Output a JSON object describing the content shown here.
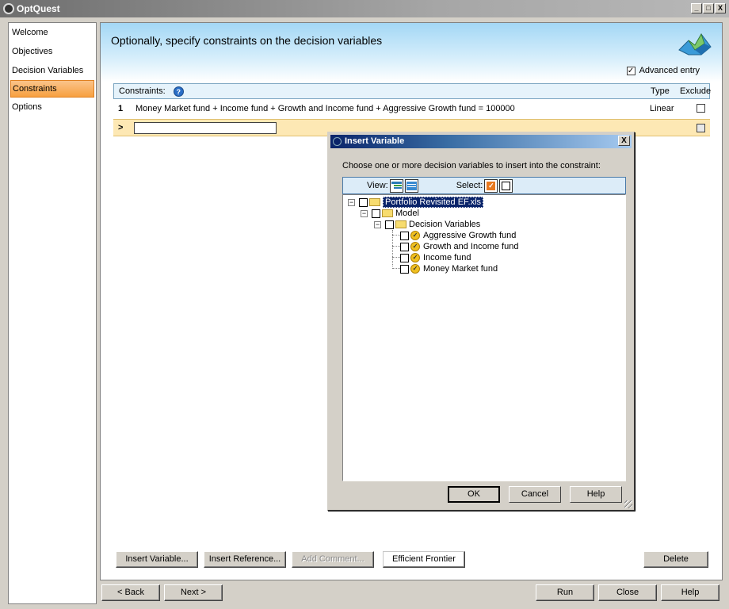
{
  "window": {
    "title": "OptQuest",
    "controls": [
      "_",
      "□",
      "X"
    ]
  },
  "nav": {
    "items": [
      {
        "label": "Welcome"
      },
      {
        "label": "Objectives"
      },
      {
        "label": "Decision Variables"
      },
      {
        "label": "Constraints",
        "active": true
      },
      {
        "label": "Options"
      }
    ]
  },
  "main": {
    "title": "Optionally, specify constraints on the decision variables",
    "advanced_entry": {
      "label": "Advanced entry",
      "checked": true
    },
    "grid": {
      "header_label": "Constraints:",
      "type_label": "Type",
      "exclude_label": "Exclude",
      "rows": [
        {
          "num": "1",
          "expression": "Money Market fund + Income fund + Growth and Income fund + Aggressive Growth fund = 100000",
          "type": "Linear",
          "exclude": false
        }
      ],
      "new_row_marker": ">"
    },
    "buttons": {
      "insert_variable": "Insert Variable...",
      "insert_reference": "Insert Reference...",
      "add_comment": "Add Comment...",
      "efficient_frontier": "Efficient Frontier",
      "delete": "Delete"
    }
  },
  "footer": {
    "back": "< Back",
    "next": "Next >",
    "run": "Run",
    "close": "Close",
    "help": "Help"
  },
  "dialog": {
    "title": "Insert Variable",
    "close": "X",
    "prompt": "Choose one or more decision variables to insert into the constraint:",
    "view_label": "View:",
    "select_label": "Select:",
    "tree": {
      "root": "Portfolio Revisited EF.xls",
      "model": "Model",
      "group": "Decision Variables",
      "variables": [
        "Aggressive Growth fund",
        "Growth and Income fund",
        "Income fund",
        "Money Market fund"
      ]
    },
    "buttons": {
      "ok": "OK",
      "cancel": "Cancel",
      "help": "Help"
    }
  },
  "colors": {
    "accent_orange": "#f7a040",
    "header_blue": "#a3d7f5",
    "dialog_title": "#0a246a",
    "new_row": "#fde8b4"
  }
}
